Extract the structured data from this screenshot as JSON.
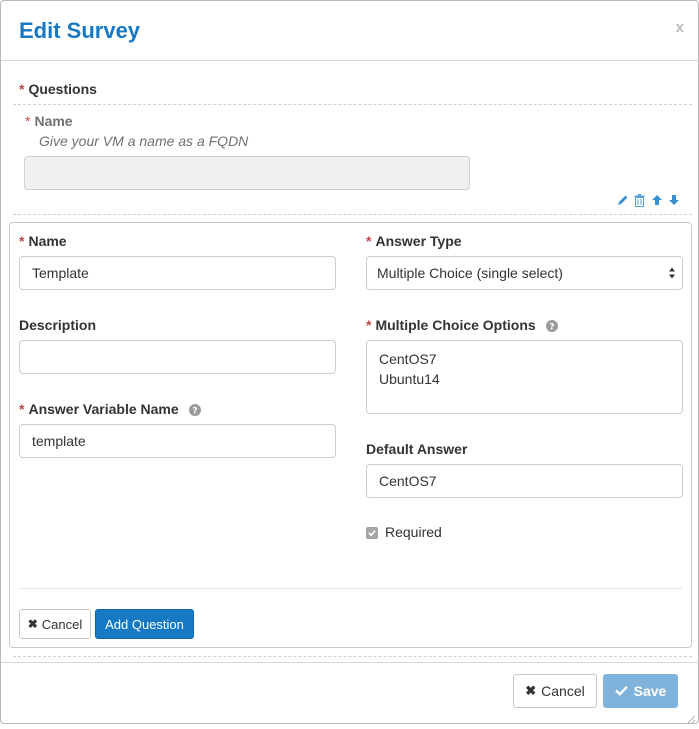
{
  "modal": {
    "title": "Edit Survey",
    "close_label": "x"
  },
  "questions": {
    "section_label": "Questions",
    "preview": {
      "name_label": "Name",
      "hint": "Give your VM a name as a FQDN",
      "icons": [
        "pencil-icon",
        "trash-icon",
        "arrow-up-icon",
        "arrow-down-icon"
      ]
    }
  },
  "form": {
    "name_label": "Name",
    "name_value": "Template",
    "description_label": "Description",
    "description_value": "",
    "variable_label": "Answer Variable Name",
    "variable_value": "template",
    "answer_type_label": "Answer Type",
    "answer_type_value": "Multiple Choice (single select)",
    "options_label": "Multiple Choice Options",
    "options": [
      "CentOS7",
      "Ubuntu14"
    ],
    "default_label": "Default Answer",
    "default_value": "CentOS7",
    "required_label": "Required",
    "required_checked": true,
    "cancel_label": "Cancel",
    "add_label": "Add Question"
  },
  "footer": {
    "cancel_label": "Cancel",
    "save_label": "Save"
  },
  "colors": {
    "accent": "#1778c3",
    "required": "#b94a48",
    "disabled_primary": "#7fb3dc"
  }
}
